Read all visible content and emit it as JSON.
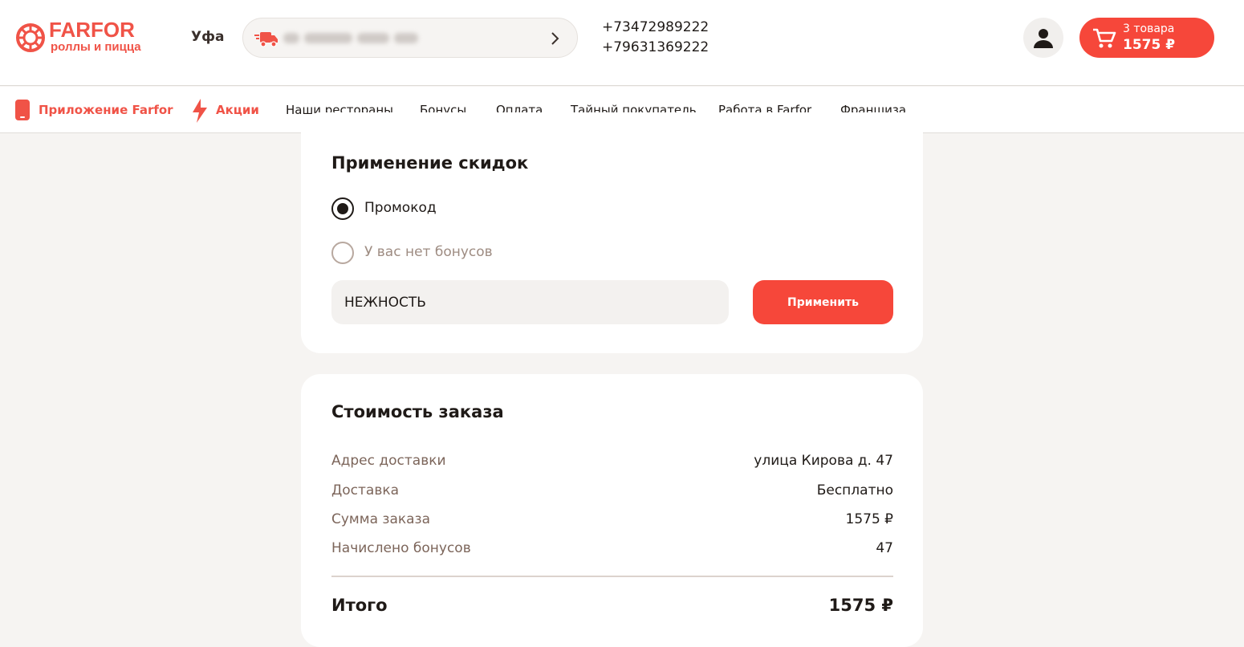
{
  "header": {
    "logo_title": "FARFOR",
    "logo_subtitle": "роллы и пицца",
    "city": "Уфа",
    "phones": [
      "+73472989222",
      "+79631369222"
    ],
    "cart": {
      "count_label": "3 товара",
      "total": "1575 ₽"
    }
  },
  "nav": {
    "items": [
      {
        "label": "Приложение Farfor",
        "accent": true,
        "icon": "phone-icon"
      },
      {
        "label": "Акции",
        "accent": true,
        "icon": "lightning-icon"
      },
      {
        "label": "Наши рестораны"
      },
      {
        "label": "Бонусы"
      },
      {
        "label": "Оплата"
      },
      {
        "label": "Тайный покупатель"
      },
      {
        "label": "Работа в Farfor"
      },
      {
        "label": "Франшиза"
      }
    ]
  },
  "discounts": {
    "title": "Применение скидок",
    "options": [
      {
        "label": "Промокод",
        "selected": true
      },
      {
        "label": "У вас нет бонусов",
        "selected": false
      }
    ],
    "promo_value": "НЕЖНОСТЬ",
    "apply_label": "Применить"
  },
  "order": {
    "title": "Стоимость заказа",
    "rows": [
      {
        "label": "Адрес доставки",
        "value": "улица Кирова д. 47"
      },
      {
        "label": "Доставка",
        "value": "Бесплатно"
      },
      {
        "label": "Сумма заказа",
        "value": "1575 ₽"
      },
      {
        "label": "Начислено бонусов",
        "value": "47"
      }
    ],
    "total_label": "Итого",
    "total_value": "1575 ₽"
  },
  "colors": {
    "accent": "#f6473a",
    "background": "#f6f4f2",
    "muted": "#7c655a"
  }
}
